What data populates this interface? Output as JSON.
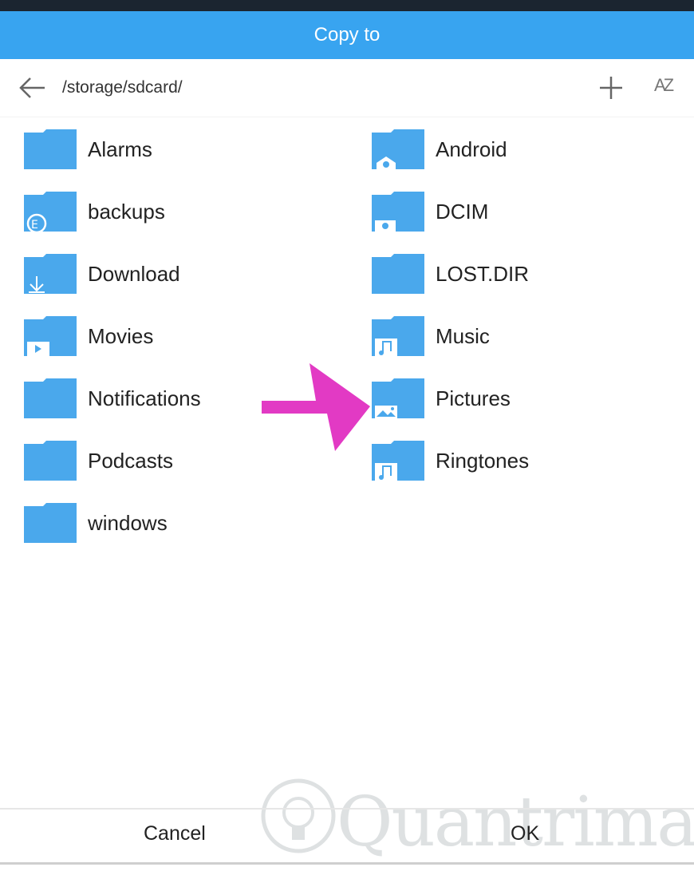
{
  "dialog": {
    "title": "Copy to"
  },
  "path": {
    "current": "/storage/sdcard/"
  },
  "toolbar": {
    "add_label": "+",
    "sort_label": "AZ"
  },
  "folders_left": [
    {
      "name": "Alarms",
      "icon": "folder-icon"
    },
    {
      "name": "backups",
      "icon": "folder-es-icon"
    },
    {
      "name": "Download",
      "icon": "folder-download-icon"
    },
    {
      "name": "Movies",
      "icon": "folder-video-icon"
    },
    {
      "name": "Notifications",
      "icon": "folder-icon"
    },
    {
      "name": "Podcasts",
      "icon": "folder-icon"
    },
    {
      "name": "windows",
      "icon": "folder-icon"
    }
  ],
  "folders_right": [
    {
      "name": "Android",
      "icon": "folder-android-icon"
    },
    {
      "name": "DCIM",
      "icon": "folder-camera-icon"
    },
    {
      "name": "LOST.DIR",
      "icon": "folder-icon"
    },
    {
      "name": "Music",
      "icon": "folder-music-icon"
    },
    {
      "name": "Pictures",
      "icon": "folder-image-icon"
    },
    {
      "name": "Ringtones",
      "icon": "folder-music-icon"
    }
  ],
  "buttons": {
    "cancel": "Cancel",
    "ok": "OK"
  },
  "watermark": {
    "text": "Quantrimang"
  },
  "colors": {
    "accent": "#38a4f0",
    "folder": "#4aa8ec",
    "arrow": "#e23ac4"
  }
}
